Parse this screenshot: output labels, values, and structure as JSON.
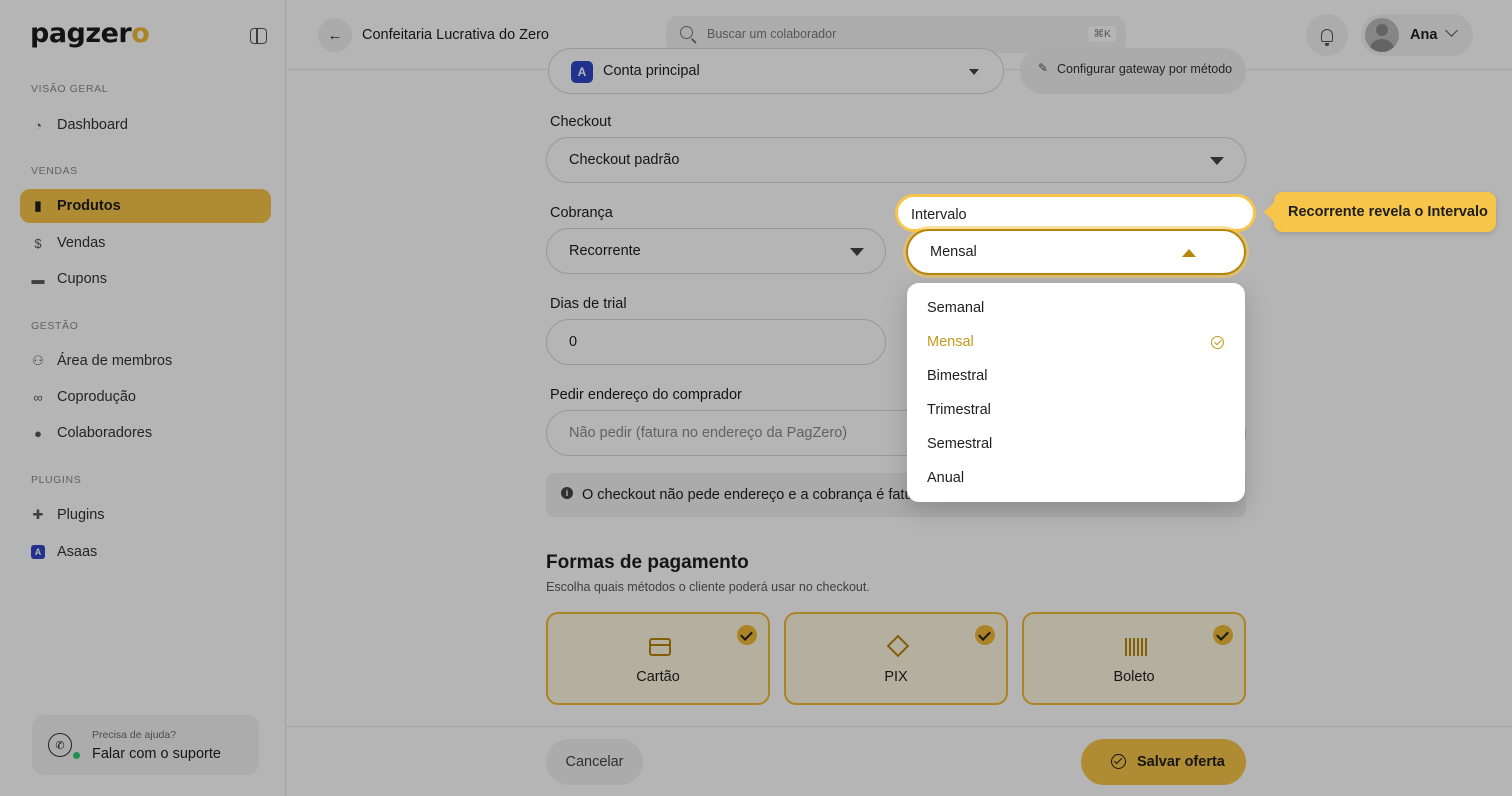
{
  "app": {
    "logo_prefix": "pagzer",
    "logo_accent": "o",
    "brand_color": "#f7c54a"
  },
  "sidebar": {
    "sections": [
      {
        "label": "VISÃO GERAL",
        "items": [
          {
            "label": "Dashboard",
            "icon": "dashboard-icon"
          }
        ]
      },
      {
        "label": "VENDAS",
        "items": [
          {
            "label": "Produtos",
            "icon": "box-icon",
            "active": true
          },
          {
            "label": "Vendas",
            "icon": "money-icon"
          },
          {
            "label": "Cupons",
            "icon": "ticket-icon"
          }
        ]
      },
      {
        "label": "GESTÃO",
        "items": [
          {
            "label": "Área de membros",
            "icon": "users-icon"
          },
          {
            "label": "Coprodução",
            "icon": "handshake-icon"
          },
          {
            "label": "Colaboradores",
            "icon": "person-icon"
          }
        ]
      },
      {
        "label": "PLUGINS",
        "items": [
          {
            "label": "Plugins",
            "icon": "puzzle-icon"
          },
          {
            "label": "Asaas",
            "icon": "asaas-icon"
          }
        ]
      }
    ],
    "support": {
      "small": "Precisa de ajuda?",
      "big": "Falar com o suporte"
    }
  },
  "header": {
    "title": "Confeitaria Lucrativa do Zero",
    "search_placeholder": "Buscar um colaborador",
    "search_shortcut": "⌘K",
    "user_name": "Ana"
  },
  "form": {
    "account_value": "Conta principal",
    "account_icon_letter": "A",
    "gateway_button": "Configurar gateway por método",
    "checkout_label": "Checkout",
    "checkout_value": "Checkout padrão",
    "cobranca_label": "Cobrança",
    "cobranca_value": "Recorrente",
    "intervalo_label": "Intervalo",
    "intervalo_value": "Mensal",
    "intervalo_options": [
      "Semanal",
      "Mensal",
      "Bimestral",
      "Trimestral",
      "Semestral",
      "Anual"
    ],
    "intervalo_selected": "Mensal",
    "trial_label": "Dias de trial",
    "trial_value": "0",
    "address_label": "Pedir endereço do comprador",
    "address_value": "Não pedir (fatura no endereço da PagZero)",
    "info_text": "O checkout não pede endereço e a cobrança é faturada"
  },
  "payments": {
    "title": "Formas de pagamento",
    "subtitle": "Escolha quais métodos o cliente poderá usar no checkout.",
    "methods": [
      {
        "label": "Cartão",
        "icon": "credit-card-icon",
        "checked": true
      },
      {
        "label": "PIX",
        "icon": "pix-icon",
        "checked": true
      },
      {
        "label": "Boleto",
        "icon": "barcode-icon",
        "checked": true
      }
    ]
  },
  "footer": {
    "cancel": "Cancelar",
    "save": "Salvar oferta"
  },
  "tour": {
    "callout": "Recorrente revela o Intervalo"
  }
}
